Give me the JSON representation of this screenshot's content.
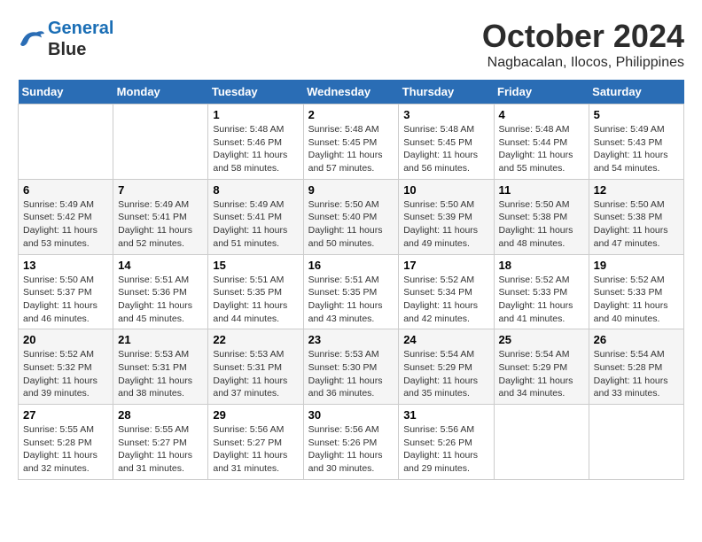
{
  "header": {
    "logo_line1": "General",
    "logo_line2": "Blue",
    "month_title": "October 2024",
    "subtitle": "Nagbacalan, Ilocos, Philippines"
  },
  "days_of_week": [
    "Sunday",
    "Monday",
    "Tuesday",
    "Wednesday",
    "Thursday",
    "Friday",
    "Saturday"
  ],
  "weeks": [
    [
      {
        "day": "",
        "sunrise": "",
        "sunset": "",
        "daylight": ""
      },
      {
        "day": "",
        "sunrise": "",
        "sunset": "",
        "daylight": ""
      },
      {
        "day": "1",
        "sunrise": "Sunrise: 5:48 AM",
        "sunset": "Sunset: 5:46 PM",
        "daylight": "Daylight: 11 hours and 58 minutes."
      },
      {
        "day": "2",
        "sunrise": "Sunrise: 5:48 AM",
        "sunset": "Sunset: 5:45 PM",
        "daylight": "Daylight: 11 hours and 57 minutes."
      },
      {
        "day": "3",
        "sunrise": "Sunrise: 5:48 AM",
        "sunset": "Sunset: 5:45 PM",
        "daylight": "Daylight: 11 hours and 56 minutes."
      },
      {
        "day": "4",
        "sunrise": "Sunrise: 5:48 AM",
        "sunset": "Sunset: 5:44 PM",
        "daylight": "Daylight: 11 hours and 55 minutes."
      },
      {
        "day": "5",
        "sunrise": "Sunrise: 5:49 AM",
        "sunset": "Sunset: 5:43 PM",
        "daylight": "Daylight: 11 hours and 54 minutes."
      }
    ],
    [
      {
        "day": "6",
        "sunrise": "Sunrise: 5:49 AM",
        "sunset": "Sunset: 5:42 PM",
        "daylight": "Daylight: 11 hours and 53 minutes."
      },
      {
        "day": "7",
        "sunrise": "Sunrise: 5:49 AM",
        "sunset": "Sunset: 5:41 PM",
        "daylight": "Daylight: 11 hours and 52 minutes."
      },
      {
        "day": "8",
        "sunrise": "Sunrise: 5:49 AM",
        "sunset": "Sunset: 5:41 PM",
        "daylight": "Daylight: 11 hours and 51 minutes."
      },
      {
        "day": "9",
        "sunrise": "Sunrise: 5:50 AM",
        "sunset": "Sunset: 5:40 PM",
        "daylight": "Daylight: 11 hours and 50 minutes."
      },
      {
        "day": "10",
        "sunrise": "Sunrise: 5:50 AM",
        "sunset": "Sunset: 5:39 PM",
        "daylight": "Daylight: 11 hours and 49 minutes."
      },
      {
        "day": "11",
        "sunrise": "Sunrise: 5:50 AM",
        "sunset": "Sunset: 5:38 PM",
        "daylight": "Daylight: 11 hours and 48 minutes."
      },
      {
        "day": "12",
        "sunrise": "Sunrise: 5:50 AM",
        "sunset": "Sunset: 5:38 PM",
        "daylight": "Daylight: 11 hours and 47 minutes."
      }
    ],
    [
      {
        "day": "13",
        "sunrise": "Sunrise: 5:50 AM",
        "sunset": "Sunset: 5:37 PM",
        "daylight": "Daylight: 11 hours and 46 minutes."
      },
      {
        "day": "14",
        "sunrise": "Sunrise: 5:51 AM",
        "sunset": "Sunset: 5:36 PM",
        "daylight": "Daylight: 11 hours and 45 minutes."
      },
      {
        "day": "15",
        "sunrise": "Sunrise: 5:51 AM",
        "sunset": "Sunset: 5:35 PM",
        "daylight": "Daylight: 11 hours and 44 minutes."
      },
      {
        "day": "16",
        "sunrise": "Sunrise: 5:51 AM",
        "sunset": "Sunset: 5:35 PM",
        "daylight": "Daylight: 11 hours and 43 minutes."
      },
      {
        "day": "17",
        "sunrise": "Sunrise: 5:52 AM",
        "sunset": "Sunset: 5:34 PM",
        "daylight": "Daylight: 11 hours and 42 minutes."
      },
      {
        "day": "18",
        "sunrise": "Sunrise: 5:52 AM",
        "sunset": "Sunset: 5:33 PM",
        "daylight": "Daylight: 11 hours and 41 minutes."
      },
      {
        "day": "19",
        "sunrise": "Sunrise: 5:52 AM",
        "sunset": "Sunset: 5:33 PM",
        "daylight": "Daylight: 11 hours and 40 minutes."
      }
    ],
    [
      {
        "day": "20",
        "sunrise": "Sunrise: 5:52 AM",
        "sunset": "Sunset: 5:32 PM",
        "daylight": "Daylight: 11 hours and 39 minutes."
      },
      {
        "day": "21",
        "sunrise": "Sunrise: 5:53 AM",
        "sunset": "Sunset: 5:31 PM",
        "daylight": "Daylight: 11 hours and 38 minutes."
      },
      {
        "day": "22",
        "sunrise": "Sunrise: 5:53 AM",
        "sunset": "Sunset: 5:31 PM",
        "daylight": "Daylight: 11 hours and 37 minutes."
      },
      {
        "day": "23",
        "sunrise": "Sunrise: 5:53 AM",
        "sunset": "Sunset: 5:30 PM",
        "daylight": "Daylight: 11 hours and 36 minutes."
      },
      {
        "day": "24",
        "sunrise": "Sunrise: 5:54 AM",
        "sunset": "Sunset: 5:29 PM",
        "daylight": "Daylight: 11 hours and 35 minutes."
      },
      {
        "day": "25",
        "sunrise": "Sunrise: 5:54 AM",
        "sunset": "Sunset: 5:29 PM",
        "daylight": "Daylight: 11 hours and 34 minutes."
      },
      {
        "day": "26",
        "sunrise": "Sunrise: 5:54 AM",
        "sunset": "Sunset: 5:28 PM",
        "daylight": "Daylight: 11 hours and 33 minutes."
      }
    ],
    [
      {
        "day": "27",
        "sunrise": "Sunrise: 5:55 AM",
        "sunset": "Sunset: 5:28 PM",
        "daylight": "Daylight: 11 hours and 32 minutes."
      },
      {
        "day": "28",
        "sunrise": "Sunrise: 5:55 AM",
        "sunset": "Sunset: 5:27 PM",
        "daylight": "Daylight: 11 hours and 31 minutes."
      },
      {
        "day": "29",
        "sunrise": "Sunrise: 5:56 AM",
        "sunset": "Sunset: 5:27 PM",
        "daylight": "Daylight: 11 hours and 31 minutes."
      },
      {
        "day": "30",
        "sunrise": "Sunrise: 5:56 AM",
        "sunset": "Sunset: 5:26 PM",
        "daylight": "Daylight: 11 hours and 30 minutes."
      },
      {
        "day": "31",
        "sunrise": "Sunrise: 5:56 AM",
        "sunset": "Sunset: 5:26 PM",
        "daylight": "Daylight: 11 hours and 29 minutes."
      },
      {
        "day": "",
        "sunrise": "",
        "sunset": "",
        "daylight": ""
      },
      {
        "day": "",
        "sunrise": "",
        "sunset": "",
        "daylight": ""
      }
    ]
  ]
}
